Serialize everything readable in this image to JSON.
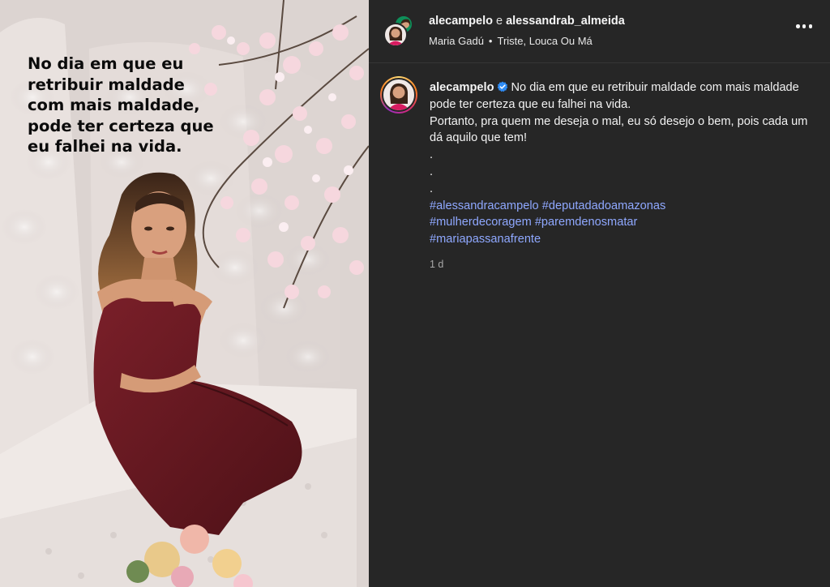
{
  "photo": {
    "overlay_text": "No dia em que eu\nretribuir maldade\ncom mais maldade,\npode ter certeza que\neu falhei na vida."
  },
  "header": {
    "owner_1": "alecampelo",
    "joiner": "e",
    "owner_2": "alessandrab_almeida",
    "artist": "Maria Gadú",
    "separator": "•",
    "song": "Triste, Louca Ou Má",
    "more_icon": "more-horizontal-icon"
  },
  "caption": {
    "username": "alecampelo",
    "verified_icon": "verified-badge-icon",
    "text_1": "No dia em que eu retribuir maldade com mais maldade pode ter certeza que eu falhei na vida.",
    "text_2": "Portanto, pra quem me deseja o mal, eu só desejo o bem, pois cada um dá aquilo que tem!",
    "dots": [
      ".",
      ".",
      "."
    ],
    "hashtags": [
      "#alessandracampelo",
      "#deputadadoamazonas",
      "#mulherdecoragem",
      "#paremdenosmatar",
      "#mariapassanafrente"
    ],
    "time": "1 d"
  },
  "colors": {
    "panel_bg": "#262626",
    "link": "#8fa8ff",
    "verified": "#2f8cf5",
    "dress": "#6b1a22"
  }
}
